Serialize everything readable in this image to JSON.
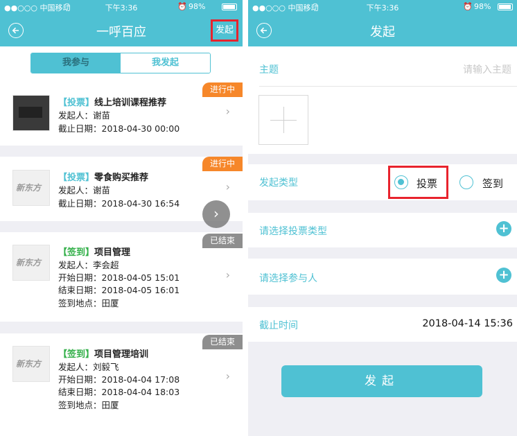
{
  "status": {
    "carrier": "●●○○○ 中国移动",
    "time": "下午3:36",
    "battery": "98%"
  },
  "list_screen": {
    "title": "一呼百应",
    "action": "发起",
    "tabs": [
      "我参与",
      "我发起"
    ],
    "items": [
      {
        "tag": "【投票】",
        "title": "线上培训课程推荐",
        "badge": "进行中",
        "lines": [
          "发起人：谢苗",
          "截止日期：2018-04-30 00:00"
        ]
      },
      {
        "tag": "【投票】",
        "title": "零食购买推荐",
        "badge": "进行中",
        "lines": [
          "发起人：谢苗",
          "截止日期：2018-04-30 16:54"
        ]
      },
      {
        "tag": "【签到】",
        "title": "项目管理",
        "badge": "已结束",
        "lines": [
          "发起人：李会超",
          "开始日期：2018-04-05 15:01",
          "结束日期：2018-04-05 16:01",
          "签到地点：田厦"
        ]
      },
      {
        "tag": "【签到】",
        "title": "项目管理培训",
        "badge": "已结束",
        "lines": [
          "发起人：刘毅飞",
          "开始日期：2018-04-04 17:08",
          "结束日期：2018-04-04 18:03",
          "签到地点：田厦"
        ]
      }
    ],
    "brand_logo_text": "新东方"
  },
  "form_screen": {
    "title": "发起",
    "subject_label": "主题",
    "subject_placeholder": "请输入主题",
    "type_label": "发起类型",
    "type_options": [
      "投票",
      "签到"
    ],
    "type_selected": "投票",
    "vote_type_label": "请选择投票类型",
    "participants_label": "请选择参与人",
    "deadline_label": "截止时间",
    "deadline_value": "2018-04-14 15:36",
    "submit_label": "发起"
  },
  "colors": {
    "accent": "#4fc1d3",
    "highlight": "#e8232d",
    "ongoing": "#f6872a",
    "ended": "#8e8e8e",
    "sign_tag": "#34b04a"
  }
}
